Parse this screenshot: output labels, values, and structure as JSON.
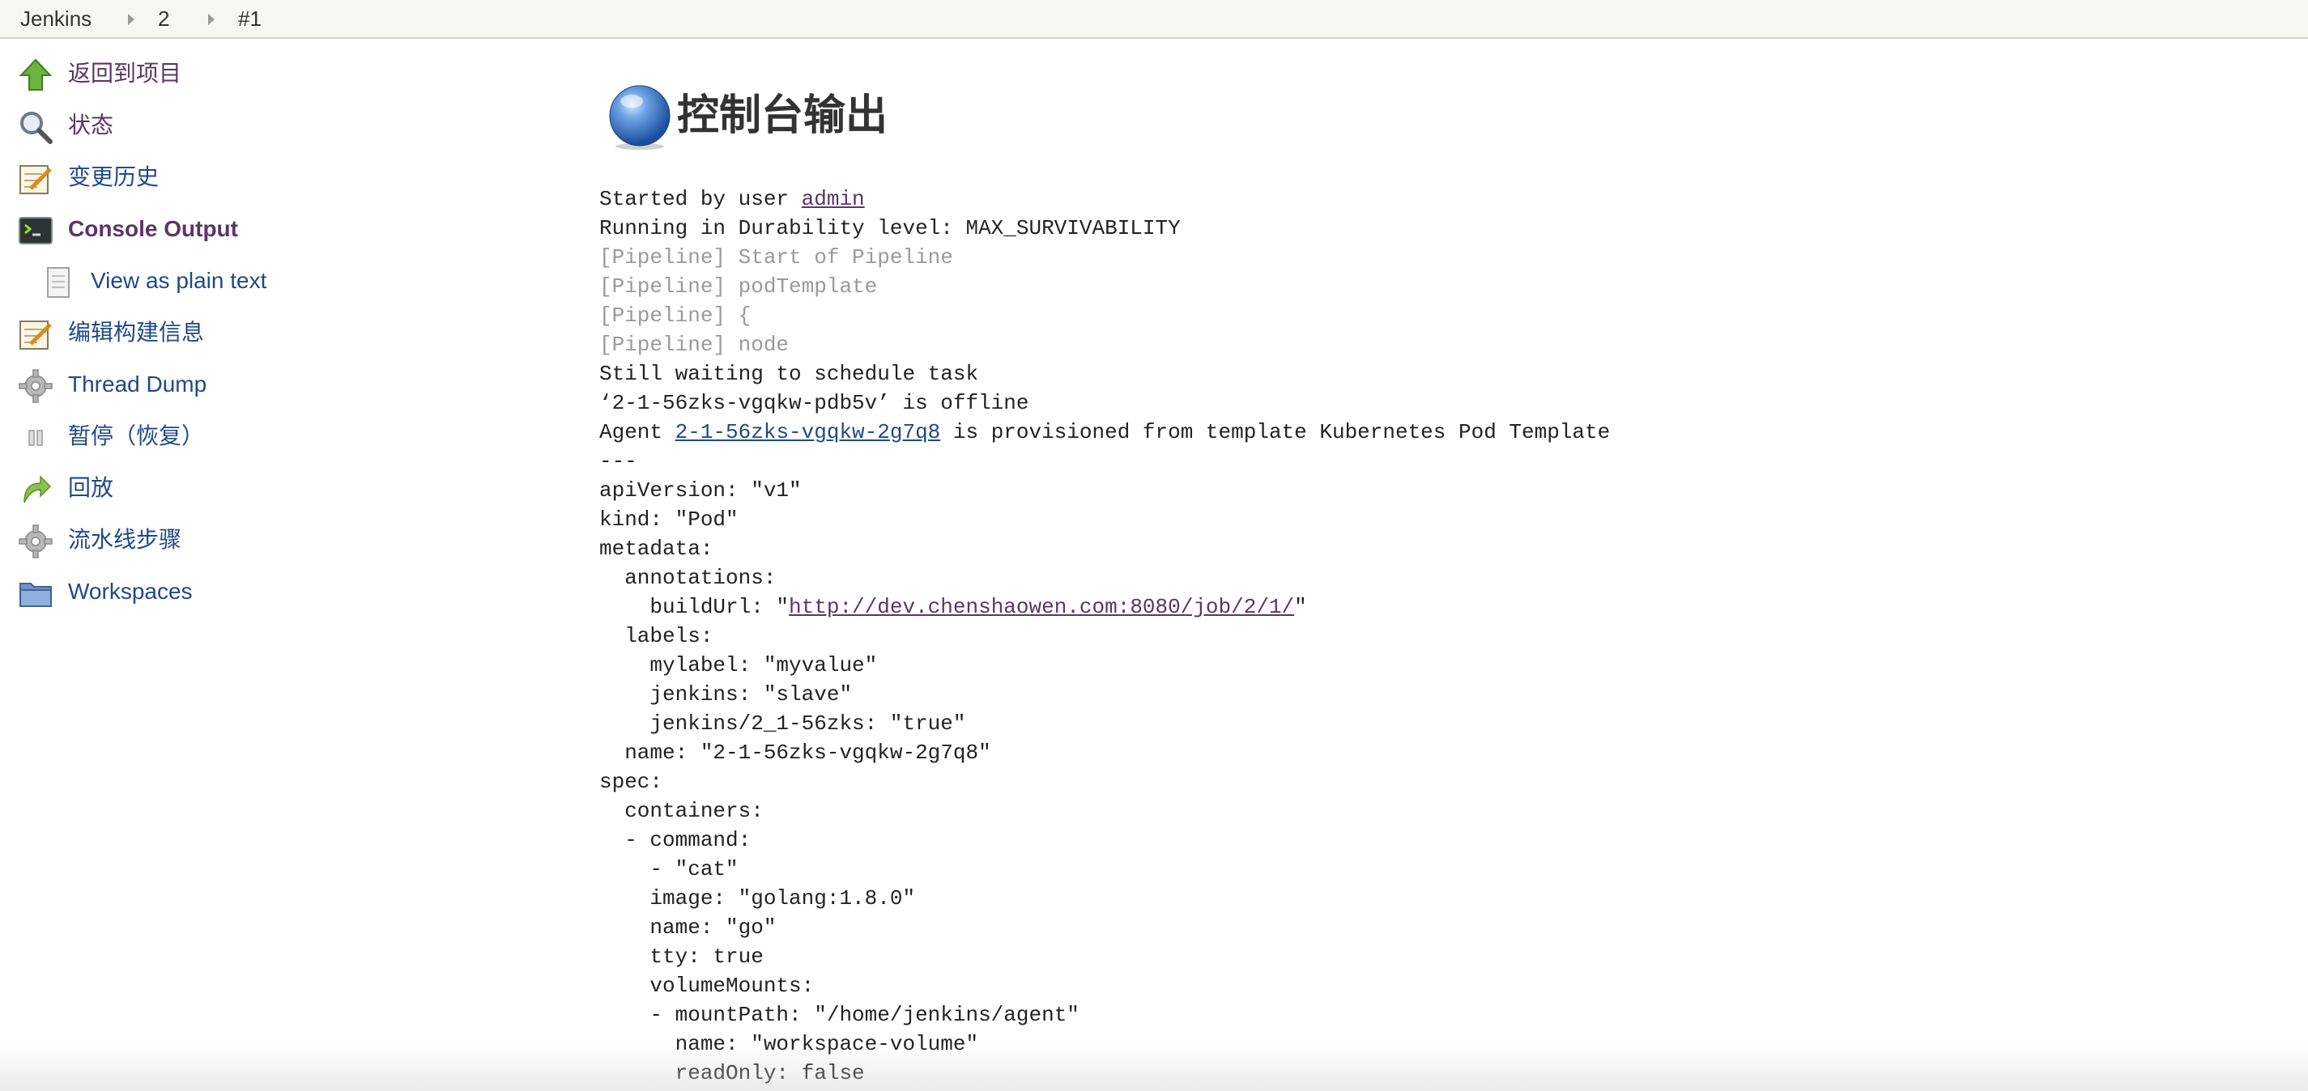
{
  "breadcrumb": {
    "items": [
      {
        "label": "Jenkins"
      },
      {
        "label": "2"
      },
      {
        "label": "#1"
      }
    ]
  },
  "sidebar": {
    "items": [
      {
        "label": "返回到项目",
        "icon": "up-arrow-icon"
      },
      {
        "label": "状态",
        "icon": "search-icon"
      },
      {
        "label": "变更历史",
        "icon": "notepad-icon"
      },
      {
        "label": "Console Output",
        "icon": "terminal-icon"
      },
      {
        "label": "View as plain text",
        "icon": "document-icon"
      },
      {
        "label": "编辑构建信息",
        "icon": "notepad-icon"
      },
      {
        "label": "Thread Dump",
        "icon": "gear-icon"
      },
      {
        "label": "暂停（恢复）",
        "icon": "pause-icon"
      },
      {
        "label": "回放",
        "icon": "replay-arrow-icon"
      },
      {
        "label": "流水线步骤",
        "icon": "gear-icon"
      },
      {
        "label": "Workspaces",
        "icon": "folder-icon"
      }
    ]
  },
  "main": {
    "title": "控制台输出",
    "title_icon": "blue-ball-icon"
  },
  "console": {
    "line1_prefix": "Started by user ",
    "line1_link": "admin",
    "line2": "Running in Durability level: MAX_SURVIVABILITY",
    "line3": "[Pipeline] Start of Pipeline",
    "line4": "[Pipeline] podTemplate",
    "line5": "[Pipeline] {",
    "line6": "[Pipeline] node",
    "line7": "Still waiting to schedule task",
    "line8": "‘2-1-56zks-vgqkw-pdb5v’ is offline",
    "line9_prefix": "Agent ",
    "line9_link": "2-1-56zks-vgqkw-2g7q8",
    "line9_suffix": " is provisioned from template Kubernetes Pod Template",
    "line10": "---",
    "line11": "apiVersion: \"v1\"",
    "line12": "kind: \"Pod\"",
    "line13": "metadata:",
    "line14": "  annotations:",
    "line15_prefix": "    buildUrl: \"",
    "line15_link": "http://dev.chenshaowen.com:8080/job/2/1/",
    "line15_suffix": "\"",
    "line16": "  labels:",
    "line17": "    mylabel: \"myvalue\"",
    "line18": "    jenkins: \"slave\"",
    "line19": "    jenkins/2_1-56zks: \"true\"",
    "line20": "  name: \"2-1-56zks-vgqkw-2g7q8\"",
    "line21": "spec:",
    "line22": "  containers:",
    "line23": "  - command:",
    "line24": "    - \"cat\"",
    "line25": "    image: \"golang:1.8.0\"",
    "line26": "    name: \"go\"",
    "line27": "    tty: true",
    "line28": "    volumeMounts:",
    "line29": "    - mountPath: \"/home/jenkins/agent\"",
    "line30": "      name: \"workspace-volume\"",
    "line31": "      readOnly: false"
  },
  "colors": {
    "link_visited": "#5c3566",
    "link": "#204a87",
    "pipeline_gray": "#9a9a9a"
  }
}
